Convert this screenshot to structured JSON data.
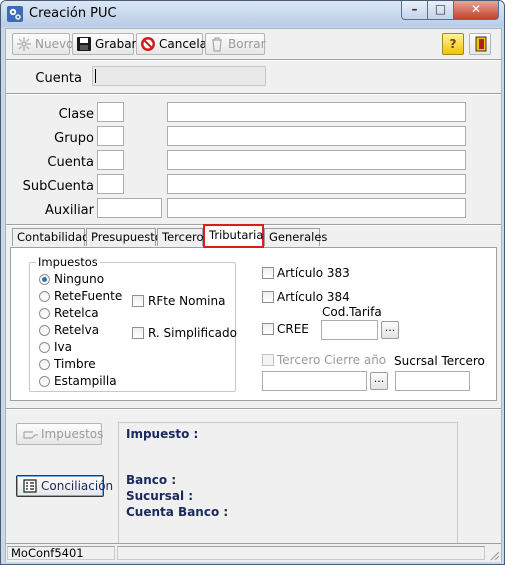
{
  "window": {
    "title": "Creación PUC",
    "minimize": "–",
    "maximize": "□",
    "close": "✕"
  },
  "toolbar": {
    "nuevo": "Nuevo",
    "grabar": "Grabar",
    "cancelar": "Cancelar",
    "borrar": "Borrar",
    "help": "?",
    "exit": "▮"
  },
  "header": {
    "cuenta_label": "Cuenta",
    "cuenta_value": ""
  },
  "classification": {
    "clase_label": "Clase",
    "grupo_label": "Grupo",
    "cuenta_label": "Cuenta",
    "subcuenta_label": "SubCuenta",
    "auxiliar_label": "Auxiliar"
  },
  "tabs": {
    "contabilidad": "Contabilidad",
    "presupuesto": "Presupuesto",
    "tercero": "Tercero",
    "tributaria": "Tributaria",
    "generales": "Generales",
    "active": "Tributaria"
  },
  "tributaria": {
    "impuestos_title": "Impuestos",
    "options": [
      "Ninguno",
      "ReteFuente",
      "Retelca",
      "Retelva",
      "Iva",
      "Timbre",
      "Estampilla"
    ],
    "selected": "Ninguno",
    "rfte_nomina": "RFte Nomina",
    "r_simplificado": "R. Simplificado",
    "articulo_383": "Artículo 383",
    "articulo_384": "Artículo 384",
    "cod_tarifa_label": "Cod.Tarifa",
    "cree": "CREE",
    "tercero_cierre": "Tercero Cierre año",
    "sucursal_tercero": "Sucrsal Tercero",
    "browse": "..."
  },
  "bottom": {
    "impuestos_btn": "Impuestos",
    "conciliacion_btn": "Conciliación",
    "impuesto_label": "Impuesto :",
    "banco_label": "Banco :",
    "sucursal_label": "Sucursal :",
    "cuenta_banco_label": "Cuenta Banco :"
  },
  "status": {
    "form_name": "MoConf5401"
  },
  "colors": {
    "active_tab_border": "#d62020",
    "info_label": "#1b2a5c"
  }
}
